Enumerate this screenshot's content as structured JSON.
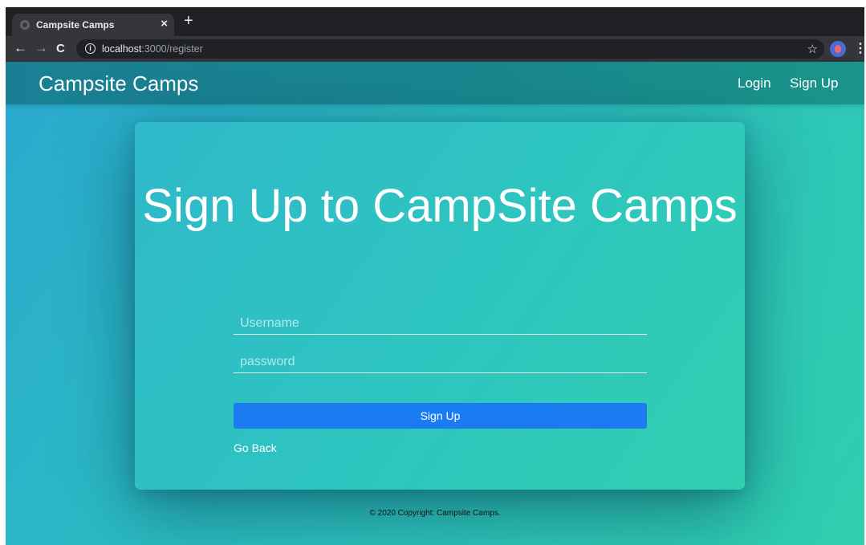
{
  "browser": {
    "tab_title": "Campsite Camps",
    "tab_close": "×",
    "new_tab": "+",
    "url_host": "localhost",
    "url_path": ":3000/register",
    "icons": [
      "back-icon",
      "forward-icon",
      "reload-icon",
      "info-icon",
      "star-icon",
      "profile-avatar",
      "menu-icon"
    ]
  },
  "navbar": {
    "brand": "Campsite Camps",
    "links": [
      "Login",
      "Sign Up"
    ]
  },
  "form": {
    "title": "Sign Up to CampSite Camps",
    "username_placeholder": "Username",
    "password_placeholder": "password",
    "submit_label": "Sign Up",
    "back_link": "Go Back"
  },
  "footer": {
    "text": "© 2020 Copyright: Campsite Camps."
  },
  "colors": {
    "accent_button": "#1a7cf0",
    "background_start": "#2aa8cf",
    "background_end": "#2fcfae"
  }
}
